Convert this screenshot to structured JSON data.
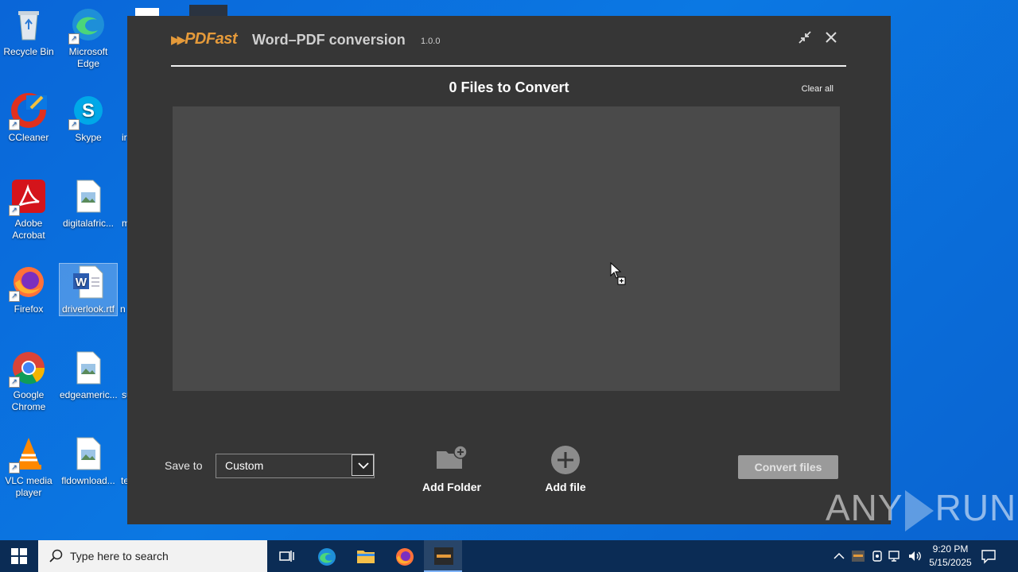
{
  "desktop": {
    "icons": [
      {
        "label": "Recycle Bin",
        "icon": "recycle-bin-icon"
      },
      {
        "label": "Microsoft Edge",
        "icon": "edge-icon"
      },
      {
        "label": "CCleaner",
        "icon": "ccleaner-icon"
      },
      {
        "label": "Skype",
        "icon": "skype-icon"
      },
      {
        "label": "Adobe Acrobat",
        "icon": "acrobat-icon"
      },
      {
        "label": "digitalafric...",
        "icon": "image-file-icon"
      },
      {
        "label": "Firefox",
        "icon": "firefox-icon"
      },
      {
        "label": "driverlook.rtf",
        "icon": "word-file-icon"
      },
      {
        "label": "Google Chrome",
        "icon": "chrome-icon"
      },
      {
        "label": "edgeameric...",
        "icon": "image-file-icon"
      },
      {
        "label": "VLC media player",
        "icon": "vlc-icon"
      },
      {
        "label": "fldownload...",
        "icon": "image-file-icon"
      }
    ],
    "peek_labels": [
      "ir",
      "m",
      "n",
      "su",
      "te"
    ]
  },
  "app": {
    "logo": "PDFast",
    "title": "Word–PDF conversion",
    "version": "1.0.0",
    "files_count": "0 Files to Convert",
    "clear_all": "Clear all",
    "save_to_label": "Save to",
    "save_to_value": "Custom",
    "add_folder": "Add Folder",
    "add_file": "Add file",
    "convert": "Convert files"
  },
  "watermark": {
    "left": "ANY",
    "right": "RUN"
  },
  "taskbar": {
    "search_placeholder": "Type here to search",
    "time": "9:20 PM",
    "date": "5/15/2025"
  }
}
